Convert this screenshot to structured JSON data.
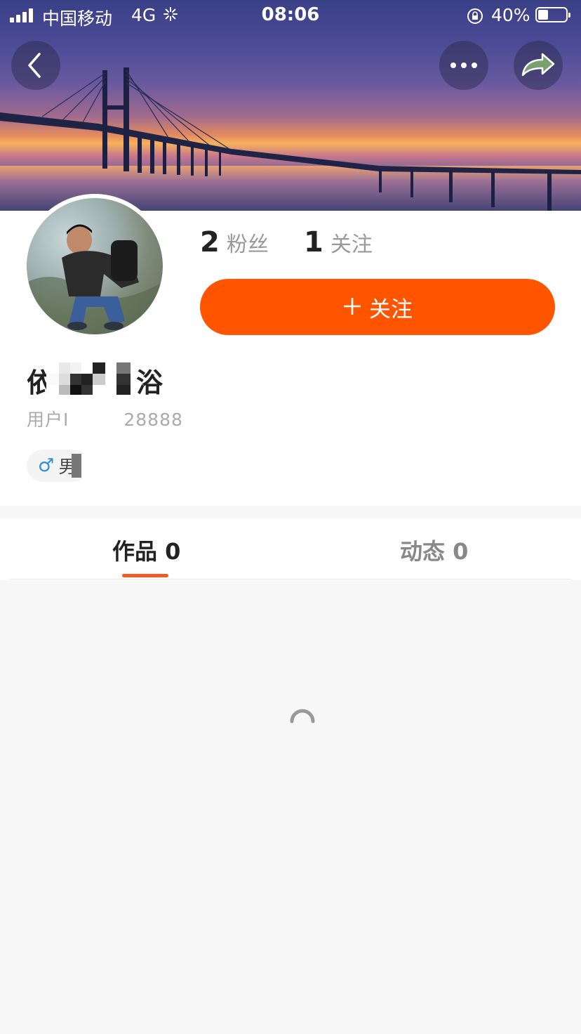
{
  "status_bar": {
    "carrier": "中国移动",
    "network": "4G",
    "time": "08:06",
    "battery_percent": "40%"
  },
  "header": {
    "back_icon": "chevron-left-icon",
    "more_icon": "more-dots-icon",
    "share_icon": "share-arrow-icon"
  },
  "profile": {
    "fans_count": "2",
    "fans_label": "粉丝",
    "following_count": "1",
    "following_label": "关注",
    "follow_button_label": "关注",
    "name_start": "依",
    "name_end": "浴",
    "user_id_start": "用户I",
    "user_id_end": "28888",
    "gender_symbol": "♂",
    "gender_label": "男"
  },
  "tabs": [
    {
      "label": "作品 0",
      "active": true
    },
    {
      "label": "动态 0",
      "active": false
    }
  ],
  "colors": {
    "accent": "#ff5500",
    "tab_indicator": "#f25a22",
    "gender_icon": "#2f8ee0"
  }
}
